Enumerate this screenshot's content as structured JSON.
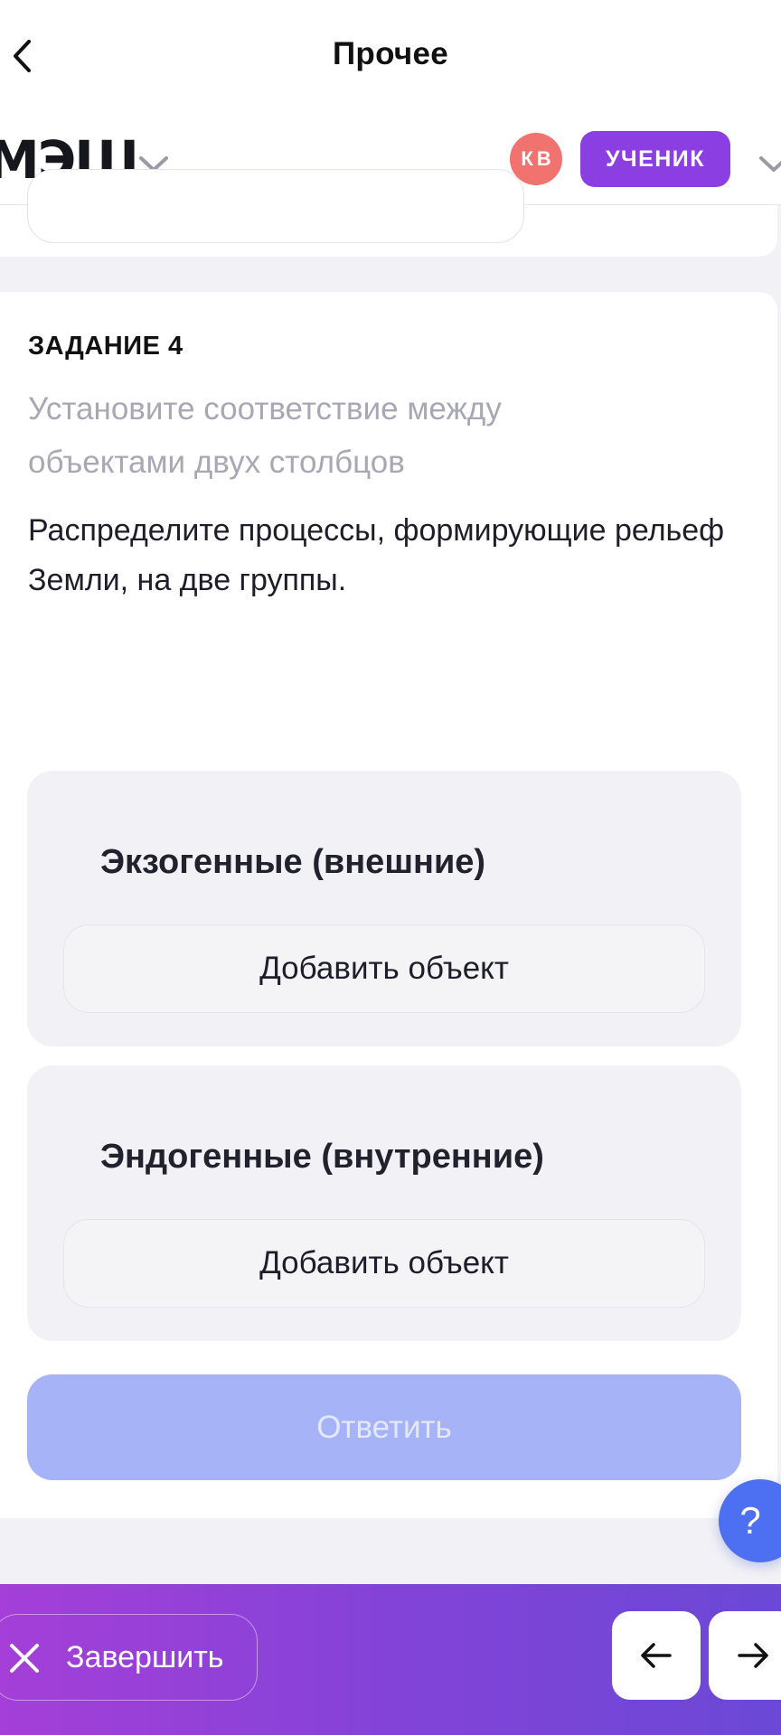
{
  "topnav": {
    "title": "Прочее",
    "back_icon": "chevron-left-icon"
  },
  "header": {
    "logo": "МЭШ",
    "avatar_initials": "КВ",
    "role_badge": "УЧЕНИК",
    "colors": {
      "avatar": "#f0736f",
      "badge": "#8b3fe2"
    }
  },
  "task": {
    "number": "ЗАДАНИЕ 4",
    "type": "Установите соответствие между объектами двух столбцов",
    "text": "Распределите процессы, формирующие рельеф Земли, на две группы.",
    "groups": [
      {
        "title": "Экзогенные (внешние)",
        "add_label": "Добавить объект"
      },
      {
        "title": "Эндогенные (внутренние)",
        "add_label": "Добавить объект"
      }
    ],
    "answer_label": "Ответить"
  },
  "help": {
    "label": "?"
  },
  "bottombar": {
    "finish_label": "Завершить",
    "prev_icon": "arrow-left-icon",
    "next_icon": "arrow-right-icon"
  },
  "colors": {
    "accent": "#8b3fe2",
    "answer_disabled": "#a6b3f7",
    "help": "#4d6ff2"
  }
}
